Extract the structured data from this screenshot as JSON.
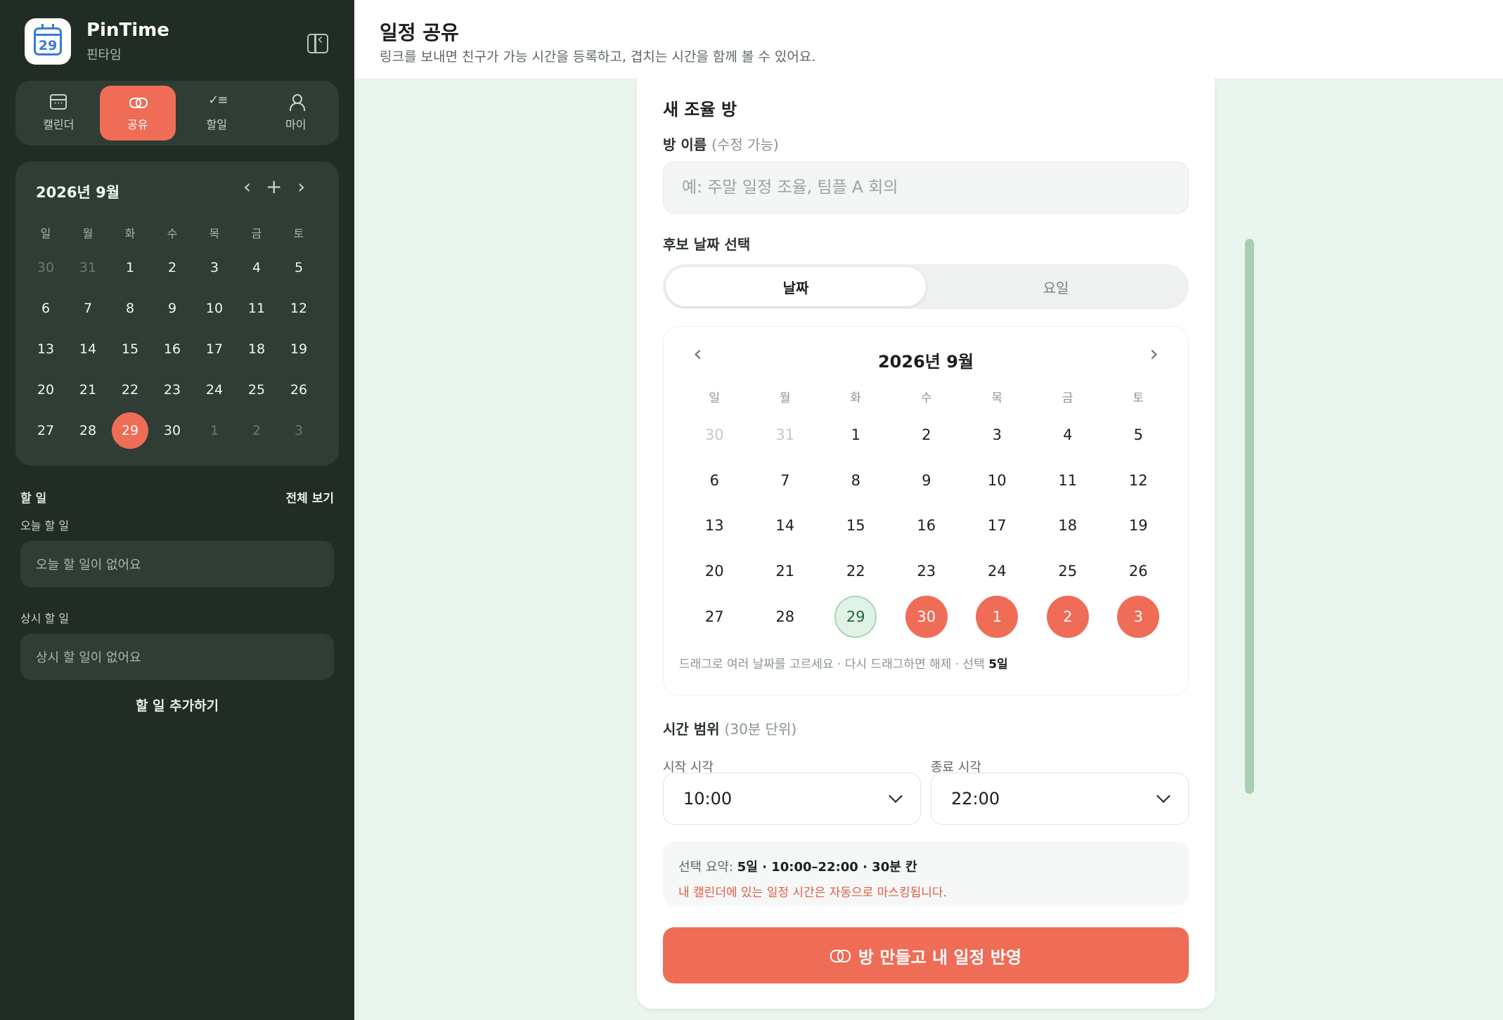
{
  "brand": {
    "title": "PinTime",
    "subtitle": "핀타임",
    "logo_day": "29"
  },
  "nav": [
    {
      "label": "캘린더",
      "icon": "calendar-icon"
    },
    {
      "label": "공유",
      "icon": "link-icon",
      "active": true
    },
    {
      "label": "할일",
      "icon": "checklist-icon"
    },
    {
      "label": "마이",
      "icon": "user-icon"
    }
  ],
  "mini_calendar": {
    "title": "2026년 9월",
    "prev": "‹",
    "add": "+",
    "next": "›",
    "weekdays": [
      "일",
      "월",
      "화",
      "수",
      "목",
      "금",
      "토"
    ],
    "days": [
      "30",
      "31",
      "1",
      "2",
      "3",
      "4",
      "5",
      "6",
      "7",
      "8",
      "9",
      "10",
      "11",
      "12",
      "13",
      "14",
      "15",
      "16",
      "17",
      "18",
      "19",
      "20",
      "21",
      "22",
      "23",
      "24",
      "25",
      "26",
      "27",
      "28",
      "29",
      "30",
      "1",
      "2",
      "3"
    ],
    "muted_indices": [
      0,
      1,
      32,
      33,
      34
    ],
    "today_index": 30
  },
  "todo": {
    "heading": "할 일",
    "view_all": "전체 보기",
    "today_title": "오늘 할 일",
    "today_empty": "오늘 할 일이 없어요",
    "always_title": "상시 할 일",
    "always_empty": "상시 할 일이 없어요",
    "add": "할 일 추가하기"
  },
  "header": {
    "title": "일정 공유",
    "subtitle": "링크를 보내면 친구가 가능 시간을 등록하고, 겹치는 시간을 함께 볼 수 있어요."
  },
  "form": {
    "title": "새 조율 방",
    "room_label": "방 이름",
    "room_hint": "(수정 가능)",
    "room_placeholder": "예: 주말 일정 조율, 팀플 A 회의",
    "room_value": "",
    "date_label": "후보 날짜 선택",
    "mode_tabs": [
      "날짜",
      "요일"
    ],
    "mode_active": 0,
    "calendar": {
      "title": "2026년 9월",
      "prev": "‹",
      "next": "›",
      "weekdays": [
        "일",
        "월",
        "화",
        "수",
        "목",
        "금",
        "토"
      ],
      "days": [
        "30",
        "31",
        "1",
        "2",
        "3",
        "4",
        "5",
        "6",
        "7",
        "8",
        "9",
        "10",
        "11",
        "12",
        "13",
        "14",
        "15",
        "16",
        "17",
        "18",
        "19",
        "20",
        "21",
        "22",
        "23",
        "24",
        "25",
        "26",
        "27",
        "28",
        "29",
        "30",
        "1",
        "2",
        "3"
      ],
      "muted_indices": [
        0,
        1
      ],
      "today_index": 30,
      "selected_indices": [
        31,
        32,
        33,
        34
      ],
      "note": "드래그로 여러 날짜를 고르세요 · 다시 드래그하면 해제 · 선택",
      "note_count": "5일"
    },
    "time_label": "시간 범위",
    "time_hint": "(30분 단위)",
    "start_label": "시작 시각",
    "start_value": "10:00",
    "end_label": "종료 시각",
    "end_value": "22:00",
    "summary_prefix": "선택 요약:",
    "summary_value": "5일 · 10:00–22:00 · 30분 칸",
    "summary_warning": "내 캘린더에 있는 일정 시간은 자동으로 마스킹됩니다.",
    "submit": "방 만들고 내 일정 반영"
  },
  "colors": {
    "accent": "#ef6c57",
    "sidebar_bg": "#212c25",
    "main_bg": "#eaf5ee"
  }
}
